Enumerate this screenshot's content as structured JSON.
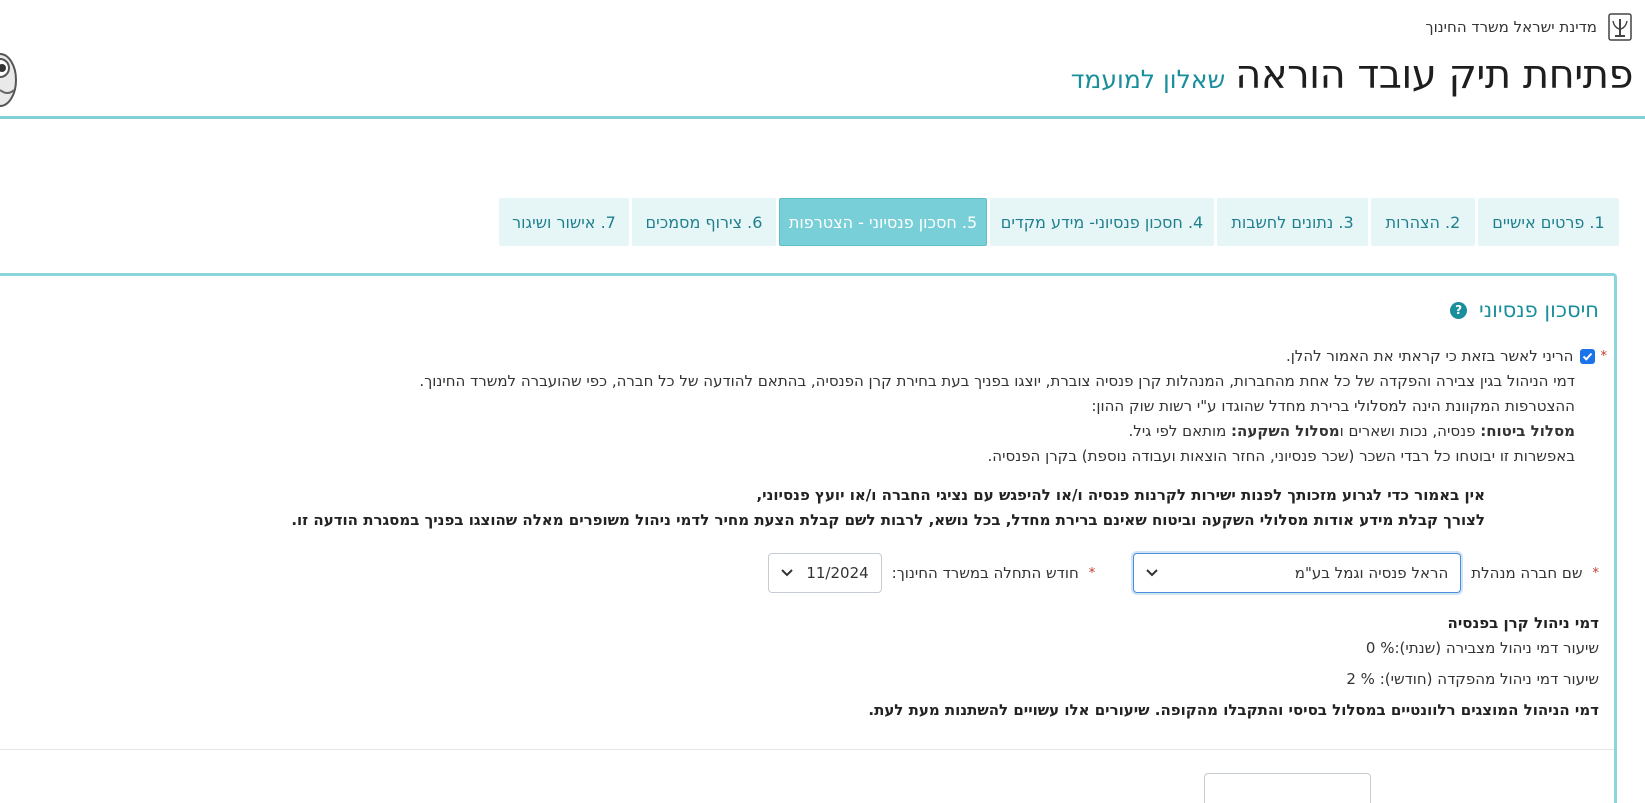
{
  "header": {
    "ministry": "מדינת ישראל משרד החינוך",
    "title": "פתיחת תיק עובד הוראה",
    "subtitle": "שאלון למועמד"
  },
  "tabs": [
    {
      "label": "1. פרטים אישיים",
      "active": false
    },
    {
      "label": "2. הצהרות",
      "active": false
    },
    {
      "label": "3. נתונים לחשבות",
      "active": false
    },
    {
      "label": "4. חסכון פנסיוני- מידע מקדים",
      "active": false
    },
    {
      "label": "5. חסכון פנסיוני - הצטרפות",
      "active": true
    },
    {
      "label": "6. צירוף מסמכים",
      "active": false
    },
    {
      "label": "7. אישור ושיגור",
      "active": false
    }
  ],
  "section": {
    "title": "חיסכון פנסיוני",
    "help_icon": "?"
  },
  "consent": {
    "required_mark": "*",
    "checkbox_checked": true,
    "line1": "הריני לאשר בזאת כי קראתי את האמור להלן.",
    "line2": "דמי הניהול בגין צבירה והפקדה של כל אחת מהחברות, המנהלות קרן פנסיה צוברת, יוצגו בפניך בעת בחירת קרן הפנסיה, בהתאם להודעה של כל חברה, כפי שהועברה למשרד החינוך.",
    "line3": "ההצטרפות המקוונת הינה למסלולי ברירת מחדל שהוגדו ע\"י רשות שוק ההון:",
    "line4_b1": "מסלול ביטוח:",
    "line4_t1": " פנסיה, נכות ושארים ו",
    "line4_b2": "מסלול השקעה:",
    "line4_t2": " מותאם לפי גיל.",
    "line5": "באפשרות זו יבוטחו כל רבדי השכר (שכר פנסיוני, החזר הוצאות ועבודה נוספת) בקרן הפנסיה."
  },
  "warning": {
    "line1": "אין באמור כדי לגרוע מזכותך לפנות ישירות לקרנות פנסיה ו/או להיפגש עם נציגי החברה ו/או יועץ פנסיוני,",
    "line2": "לצורך קבלת מידע אודות מסלולי השקעה וביטוח שאינם ברירת מחדל, בכל נושא, לרבות לשם קבלת הצעת מחיר לדמי ניהול משופרים מאלה שהוצגו בפניך במסגרת הודעה זו."
  },
  "form": {
    "company_label": "שם חברה מנהלת",
    "company_value": "הראל פנסיה וגמל בע\"מ",
    "month_label": "חודש התחלה במשרד החינוך:",
    "month_value": "11/2024",
    "required_mark": "*"
  },
  "fees": {
    "title": "דמי ניהול קרן בפנסיה",
    "accum_label": "שיעור דמי ניהול מצבירה (שנתי):",
    "accum_value": "% 0",
    "deposit_label": "שיעור דמי ניהול מהפקדה (חודשי):",
    "deposit_value": "% 2",
    "note": "דמי הניהול המוצגים רלוונטיים במסלול בסיסי והתקבלו מהקופה. שיעורים אלו עשויים להשתנות מעת לעת."
  },
  "icons": {
    "emblem": "state-emblem-icon",
    "mascot": "owl-mascot-icon",
    "chevron": "chevron-down-icon",
    "check": "checkmark-icon"
  },
  "colors": {
    "accent": "#1a8f9c",
    "tab_bg": "#e6f6f7",
    "tab_active": "#78cfd7",
    "border": "#8ad6dc"
  }
}
